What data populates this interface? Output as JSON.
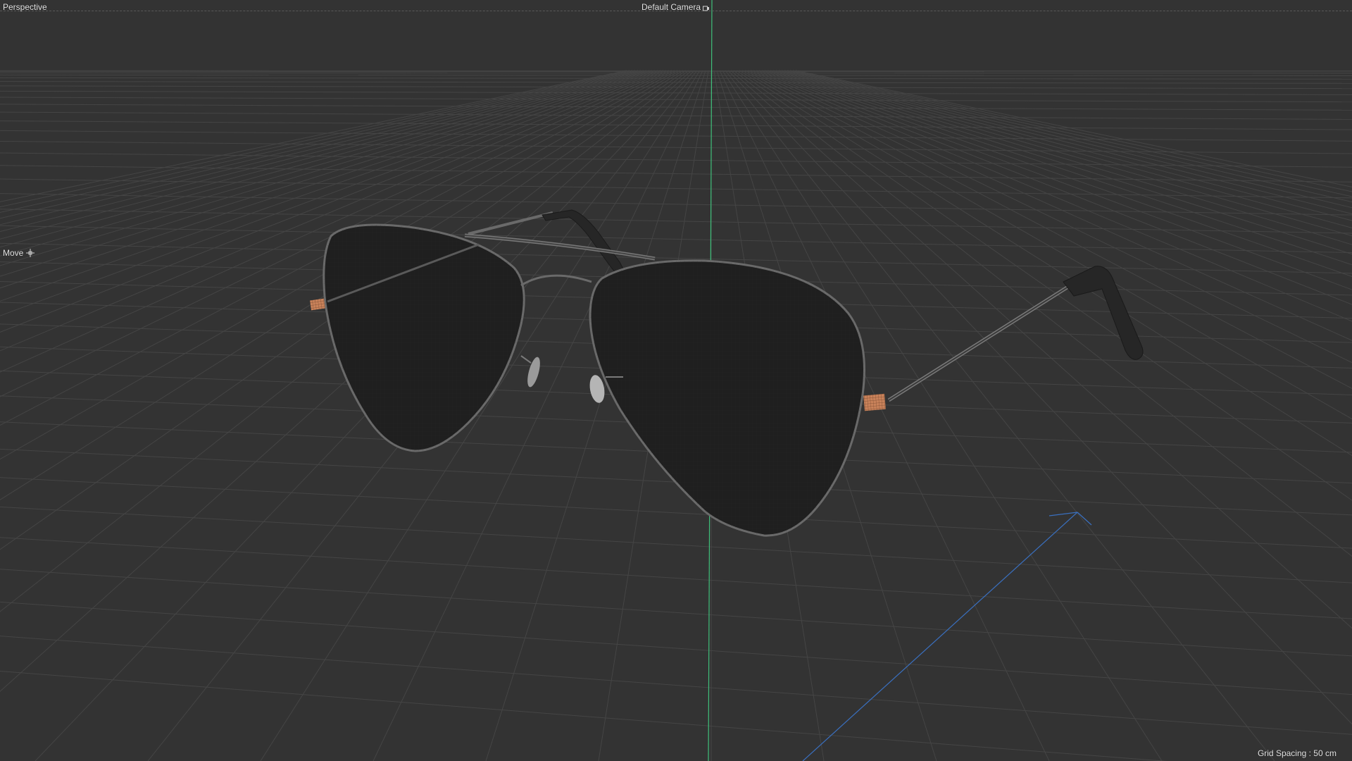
{
  "viewport": {
    "view_label": "Perspective",
    "camera_label": "Default Camera",
    "camera_icon": "camera-lock-icon",
    "tool_label": "Move",
    "tool_icon": "move-crosshair-icon",
    "grid_spacing_label": "Grid Spacing : 50 cm"
  },
  "scene": {
    "object": "aviator-sunglasses",
    "colors": {
      "background": "#333333",
      "grid": "#454545",
      "y_axis": "#3fbf7a",
      "world_axis": "#3a70c0",
      "lens": "#1f1f1f",
      "frame": "#6a6a6a",
      "hinge": "#c9825a",
      "temple_tip": "#262626"
    }
  }
}
